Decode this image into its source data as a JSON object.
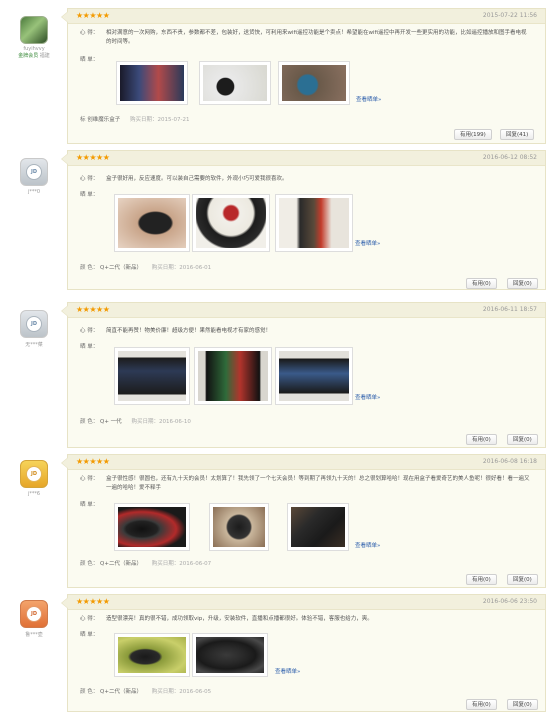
{
  "reviews": [
    {
      "user": "fuyihvvy",
      "level": "金牌会员",
      "city": "福建",
      "stars": "★★★★★",
      "date": "2015-07-22 11:56",
      "xinde": "相对满意的一次网购，东西不贵，参数都不差，包装好，送货快，可利用来wifi遥控功能是个卖点！希望能在wifi遥控中再开发一些更实用的功能，比如遥控播放和图手看电视的时间等。",
      "label_xinde": "心 得：",
      "label_shaidan": "晒 单：",
      "view_more": "查看晒单»",
      "meta_label": "标",
      "meta_value": "创维魔乐盒子",
      "buy_label": "购买日期：",
      "buy_date": "2015-07-21",
      "useful": "有用(199)",
      "reply": "回复(41)"
    },
    {
      "user": "j***0",
      "stars": "★★★★★",
      "date": "2016-06-12 08:52",
      "xinde": "盒子很好用，反应速度。可以装自己需要的软件，外观小巧可爱我很喜欢。",
      "label_xinde": "心 得：",
      "label_shaidan": "晒 单：",
      "view_more": "查看晒单»",
      "meta_label": "颜 色：",
      "meta_value": "Q+二代（新品）",
      "buy_label": "购买日期：",
      "buy_date": "2016-06-01",
      "useful": "有用(0)",
      "reply": "回复(0)"
    },
    {
      "user": "无***菜",
      "stars": "★★★★★",
      "date": "2016-06-11 18:57",
      "xinde": "简直不能再赞！物美价廉！超级方便！果然能看电视才有家的感觉！",
      "label_xinde": "心 得：",
      "label_shaidan": "晒 单：",
      "view_more": "查看晒单»",
      "meta_label": "颜 色：",
      "meta_value": "Q+ 一代",
      "buy_label": "购买日期：",
      "buy_date": "2016-06-10",
      "useful": "有用(0)",
      "reply": "回复(0)"
    },
    {
      "user": "j***6",
      "stars": "★★★★★",
      "date": "2016-06-08 16:18",
      "xinde": "盒子很性感！很圆也，还有九十天的会员！太划算了！我先领了一个七天会员！等到期了再领九十天的！总之很划算哈哈！现在用盒子看爱奇艺的美人鱼呢！很好看！看一遍又一遍的哈哈！爱不释手",
      "label_xinde": "心 得：",
      "label_shaidan": "晒 单：",
      "view_more": "查看晒单»",
      "meta_label": "颜 色：",
      "meta_value": "Q+二代（新品）",
      "buy_label": "购买日期：",
      "buy_date": "2016-06-07",
      "useful": "有用(0)",
      "reply": "回复(0)"
    },
    {
      "user": "鲁***壶",
      "stars": "★★★★★",
      "date": "2016-06-06 23:50",
      "xinde": "造型很漂亮！真的很不错，成功领取vip，升级，安装软件，直播和点播都很好。体验不错，客服也给力，爽。",
      "label_xinde": "心 得：",
      "label_shaidan": "晒 单：",
      "view_more": "查看晒单»",
      "meta_label": "颜 色：",
      "meta_value": "Q+二代（新品）",
      "buy_label": "购买日期：",
      "buy_date": "2016-06-05",
      "useful": "有用(0)",
      "reply": "回复(0)"
    }
  ],
  "avatar_badge": "JD",
  "colors": {
    "star": "#f39a00",
    "link": "#2a5caa",
    "card_bg": "#fbfbf1",
    "card_border": "#e7e3c6"
  }
}
